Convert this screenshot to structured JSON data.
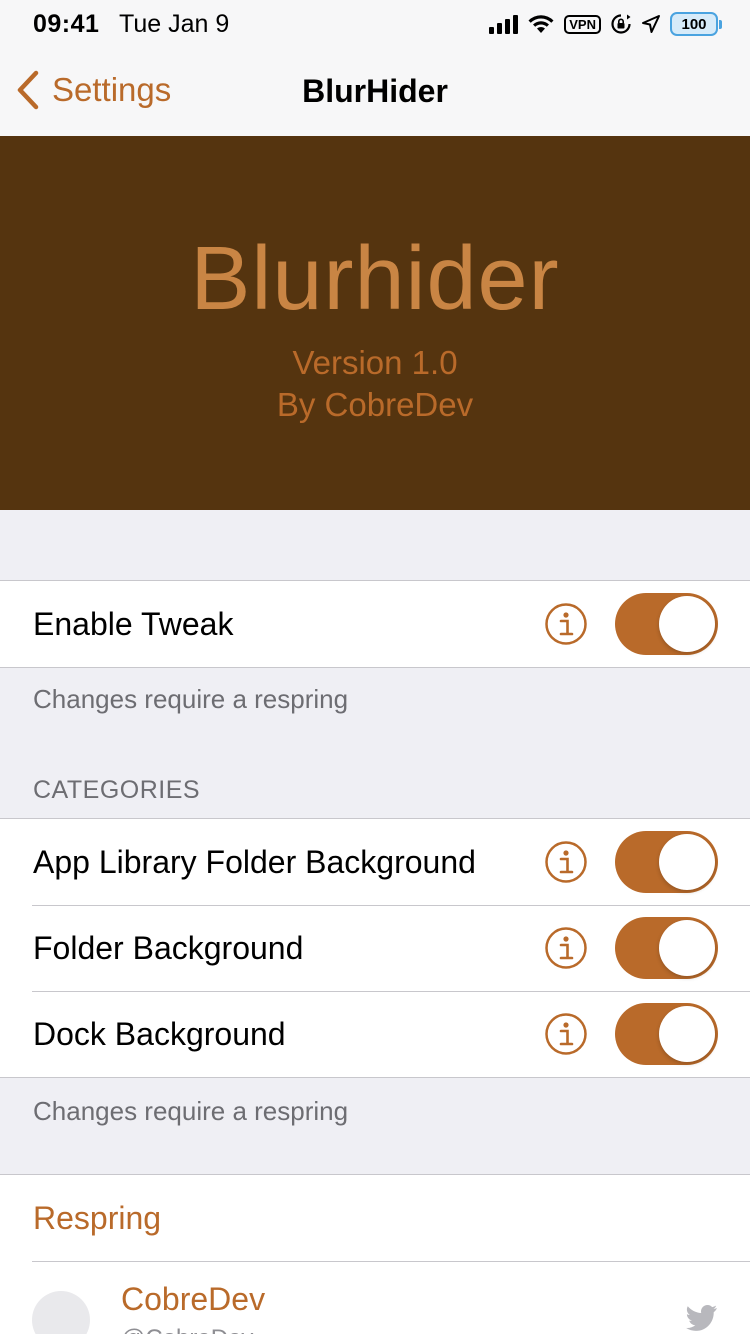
{
  "status_bar": {
    "time": "09:41",
    "date": "Tue Jan 9",
    "vpn_label": "VPN",
    "battery_level": "100"
  },
  "nav": {
    "back_label": "Settings",
    "title": "BlurHider"
  },
  "header": {
    "title": "Blurhider",
    "version": "Version 1.0",
    "author": "By CobreDev"
  },
  "main_group": {
    "items": [
      {
        "label": "Enable Tweak",
        "enabled": true
      }
    ],
    "footer": "Changes require a respring"
  },
  "categories": {
    "header": "CATEGORIES",
    "items": [
      {
        "label": "App Library Folder Background",
        "enabled": true
      },
      {
        "label": "Folder Background",
        "enabled": true
      },
      {
        "label": "Dock Background",
        "enabled": true
      }
    ],
    "footer": "Changes require a respring"
  },
  "actions": {
    "respring_label": "Respring",
    "developer_name": "CobreDev",
    "developer_handle": "@CobreDev"
  },
  "colors": {
    "accent": "#b96a2a",
    "banner_bg": "#55340f",
    "banner_title": "#c98544",
    "background": "#efeff4"
  },
  "icons": [
    "back-chevron-icon",
    "wifi-icon",
    "orientation-lock-icon",
    "location-icon",
    "info-icon",
    "twitter-icon"
  ]
}
